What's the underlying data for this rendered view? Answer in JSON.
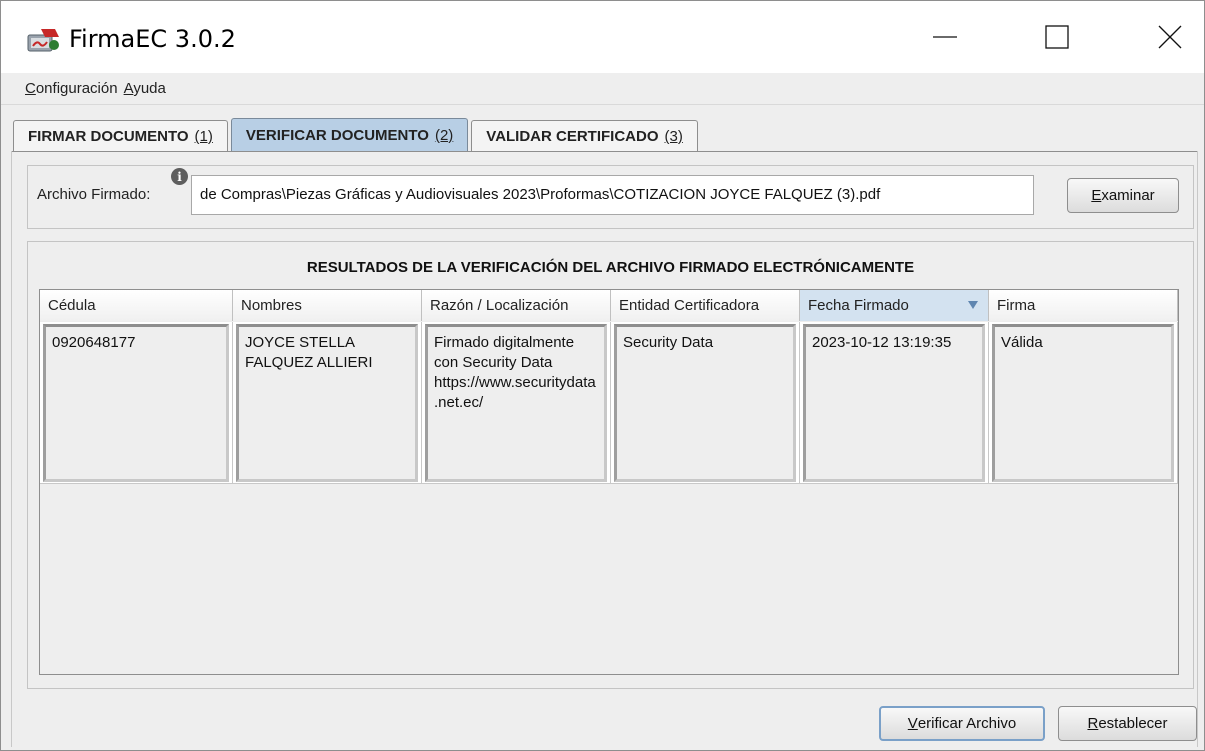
{
  "window": {
    "title": "FirmaEC 3.0.2",
    "icons": {
      "app": "signature-app-icon",
      "minimize": "minimize-icon",
      "maximize": "maximize-icon",
      "close": "close-icon"
    }
  },
  "menu": {
    "items": [
      {
        "first": "C",
        "rest": "onfiguración"
      },
      {
        "first": "A",
        "rest": "yuda"
      }
    ]
  },
  "tabs": [
    {
      "label": "FIRMAR DOCUMENTO",
      "num": "(1)",
      "active": false
    },
    {
      "label": "VERIFICAR DOCUMENTO",
      "num": "(2)",
      "active": true
    },
    {
      "label": "VALIDAR CERTIFICADO",
      "num": "(3)",
      "active": false
    }
  ],
  "file": {
    "label": "Archivo Firmado:",
    "info_icon": "i",
    "value": "de Compras\\Piezas Gráficas y Audiovisuales 2023\\Proformas\\COTIZACION JOYCE FALQUEZ (3).pdf",
    "browse_first": "E",
    "browse_rest": "xaminar"
  },
  "results": {
    "title": "RESULTADOS DE LA VERIFICACIÓN DEL ARCHIVO FIRMADO ELECTRÓNICAMENTE",
    "columns": [
      "Cédula",
      "Nombres",
      "Razón / Localización",
      "Entidad Certificadora",
      "Fecha Firmado",
      "Firma"
    ],
    "sorted_column": "Fecha Firmado",
    "rows": [
      {
        "cedula": "0920648177",
        "nombres": "JOYCE STELLA FALQUEZ ALLIERI",
        "razon": "Firmado digitalmente con Security Data https://www.securitydata.net.ec/",
        "entidad": "Security Data",
        "fecha": "2023-10-12 13:19:35",
        "firma": "Válida"
      }
    ]
  },
  "actions": {
    "verify_first": "V",
    "verify_rest": "erificar Archivo",
    "reset_first": "R",
    "reset_rest": "establecer"
  }
}
